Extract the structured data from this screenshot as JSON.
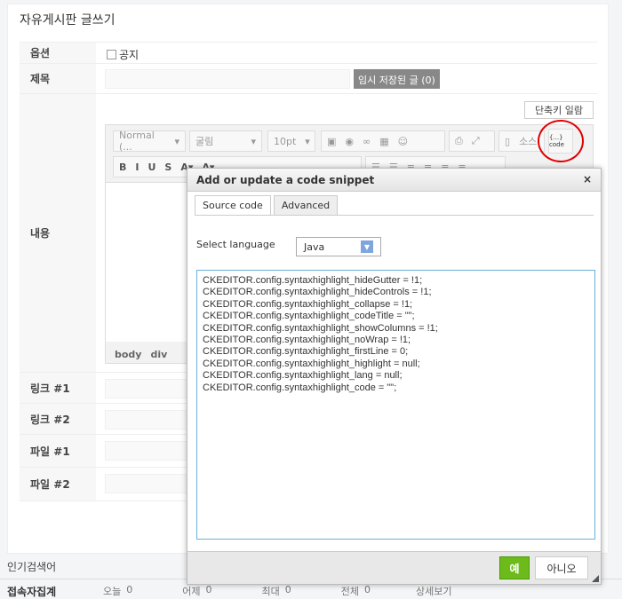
{
  "page": {
    "title": "자유게시판 글쓰기"
  },
  "form": {
    "option_label": "옵션",
    "notice_label": "공지",
    "subject_label": "제목",
    "temp_saved_button": "임시 저장된 글 (0)",
    "content_label": "내용",
    "shortcut_button": "단축키 일람",
    "link1_label": "링크 #1",
    "link2_label": "링크 #2",
    "file1_label": "파일 #1",
    "file2_label": "파일 #2"
  },
  "editor": {
    "format": "Normal (...",
    "font": "굴림",
    "size": "10pt",
    "source": "소스",
    "code_button": "{...} code",
    "path": [
      "body",
      "div"
    ],
    "row2": [
      "B",
      "I",
      "U",
      "S",
      "A▾",
      "A▾"
    ]
  },
  "dialog": {
    "title": "Add or update a code snippet",
    "close": "×",
    "tabs": [
      "Source code",
      "Advanced"
    ],
    "select_language_label": "Select language",
    "language": "Java",
    "code": "CKEDITOR.config.syntaxhighlight_hideGutter = !1;\nCKEDITOR.config.syntaxhighlight_hideControls = !1;\nCKEDITOR.config.syntaxhighlight_collapse = !1;\nCKEDITOR.config.syntaxhighlight_codeTitle = \"\";\nCKEDITOR.config.syntaxhighlight_showColumns = !1;\nCKEDITOR.config.syntaxhighlight_noWrap = !1;\nCKEDITOR.config.syntaxhighlight_firstLine = 0;\nCKEDITOR.config.syntaxhighlight_highlight = null;\nCKEDITOR.config.syntaxhighlight_lang = null;\nCKEDITOR.config.syntaxhighlight_code = \"\";",
    "ok": "예",
    "cancel": "아니오"
  },
  "footer": {
    "popular": "인기검색어",
    "visitors": "접속자집계",
    "today": "오늘",
    "today_v": "0",
    "yesterday": "어제",
    "yesterday_v": "0",
    "max": "최대",
    "max_v": "0",
    "total": "전체",
    "total_v": "0",
    "detail": "상세보기"
  },
  "colors": {
    "ok": "#6dbb1a",
    "highlight_circle": "#e00000"
  }
}
